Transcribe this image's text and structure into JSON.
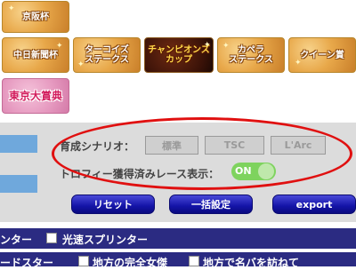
{
  "races": [
    {
      "label": "京阪杯"
    },
    {
      "label": "中日新聞杯"
    },
    {
      "label": "ターコイズ\nステークス"
    },
    {
      "label": "チャンピオンズ\nカップ"
    },
    {
      "label": "カペラ\nステークス"
    },
    {
      "label": "クイーン賞"
    },
    {
      "label": "東京大賞典"
    }
  ],
  "panel": {
    "scenario_label": "育成シナリオ：",
    "scenario_options": [
      "標準",
      "TSC",
      "L'Arc"
    ],
    "trophy_label": "トロフィー獲得済みレース表示：",
    "trophy_toggle": "ON",
    "buttons": {
      "reset": "リセット",
      "bulk": "一括設定",
      "export": "export"
    }
  },
  "filters": {
    "row1_left": "ンター",
    "row1_check": "光速スプリンター",
    "row2_left": "ードスター",
    "row2_check_a": "地方の完全女傑",
    "row2_check_b": "地方で名バを訪ねて"
  },
  "colors": {
    "tile_gold": "#e8a84a",
    "tile_dark": "#3a1208",
    "tile_pink": "#e69ac0",
    "panel_bg": "#dcdcdc",
    "button_blue": "#1414a8",
    "bar_navy": "#2b2b82",
    "toggle_green": "#7ed35e",
    "highlight_red": "#e01010"
  }
}
